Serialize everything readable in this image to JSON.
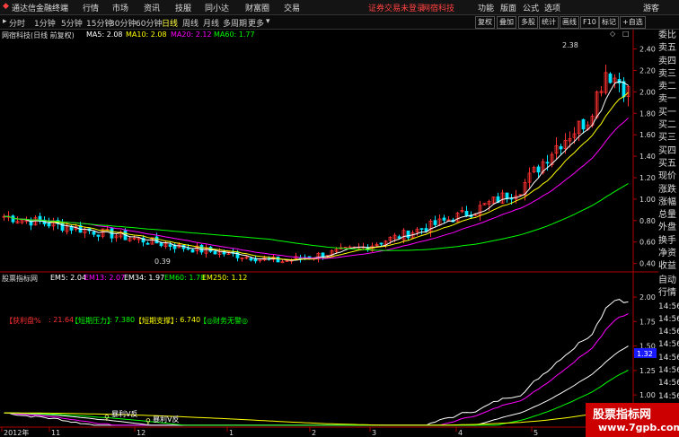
{
  "app": {
    "name": "通达信金融终端",
    "menu": [
      "行情",
      "市场",
      "资讯",
      "技服",
      "同小达",
      "财富圈",
      "交易"
    ],
    "notice": "证券交易未登录",
    "notice2": "网宿科技",
    "right_menu": [
      "功能",
      "版面",
      "公式",
      "选项"
    ],
    "user": "游客"
  },
  "toolbar": {
    "periods": [
      "分时",
      "1分钟",
      "5分钟",
      "15分钟",
      "30分钟",
      "60分钟",
      "日线",
      "周线",
      "月线",
      "多周期",
      "更多"
    ],
    "active_period": "日线",
    "right_buttons": [
      "复权",
      "叠加",
      "多股",
      "统计",
      "画线",
      "F10",
      "标记",
      "+自选"
    ]
  },
  "main_chart": {
    "stock_label": "网宿科技(日线 前复权)",
    "ma": [
      {
        "label": "MA5: 2.08",
        "color": "#ffffff"
      },
      {
        "label": "MA10: 2.08",
        "color": "#ffff00"
      },
      {
        "label": "MA20: 2.12",
        "color": "#ff00ff"
      },
      {
        "label": "MA60: 1.77",
        "color": "#00ff00"
      }
    ],
    "y_ticks": [
      "2.40",
      "2.20",
      "2.00",
      "1.80",
      "1.60",
      "1.40",
      "1.20",
      "1.00",
      "0.80",
      "0.60",
      "0.40"
    ],
    "high_label": "2.38",
    "low_label": "0.39"
  },
  "sub_chart": {
    "indicator_name": "股票指标网",
    "em": [
      {
        "label": "EM5: 2.04",
        "color": "#ffffff"
      },
      {
        "label": "EM13: 2.07",
        "color": "#ff00ff"
      },
      {
        "label": "EM34: 1.97",
        "color": "#ffffff"
      },
      {
        "label": "EM60: 1.78",
        "color": "#00ff00"
      },
      {
        "label": "EM250: 1.12",
        "color": "#ffff00"
      }
    ],
    "legend": [
      {
        "label": "【获利盘%",
        "color": "#ff3030"
      },
      {
        "label": ": 21.64",
        "color": "#ff3030"
      },
      {
        "label": "【短期压力】",
        "color": "#00ff00"
      },
      {
        "label": ": 7.380",
        "color": "#00ff00"
      },
      {
        "label": "【短期支撑】",
        "color": "#ffff00"
      },
      {
        "label": ": 6.740",
        "color": "#ffff00"
      },
      {
        "label": "【◎财务无警◎",
        "color": "#00ff00"
      }
    ],
    "y_ticks": [
      "2.00",
      "1.75",
      "1.50",
      "1.25",
      "1.00",
      "0.75"
    ],
    "current_value": "1.32",
    "markers": [
      "暴利V反",
      "暴利V反"
    ]
  },
  "x_axis": {
    "labels": [
      "2012年",
      "11",
      "12",
      "1",
      "2",
      "3",
      "4",
      "5"
    ]
  },
  "side_panel": {
    "items": [
      "委比",
      "卖五",
      "卖四",
      "卖三",
      "卖二",
      "卖一",
      "买一",
      "买二",
      "买三",
      "买四",
      "买五",
      "现价",
      "涨跌",
      "涨幅",
      "总量",
      "外盘",
      "换手",
      "净资",
      "收益"
    ],
    "items2": [
      "自动",
      "行情"
    ],
    "times": [
      "14:56",
      "14:56",
      "14:56",
      "14:56",
      "14:56",
      "14:56",
      "14:56",
      "14:56",
      "14:56",
      "14:56",
      "14:56"
    ]
  },
  "watermark": {
    "line1": "股票指标网",
    "line2": "www.7gpb.com"
  },
  "colors": {
    "up": "#ff3030",
    "down": "#00e5ff",
    "axis": "#b00000"
  }
}
